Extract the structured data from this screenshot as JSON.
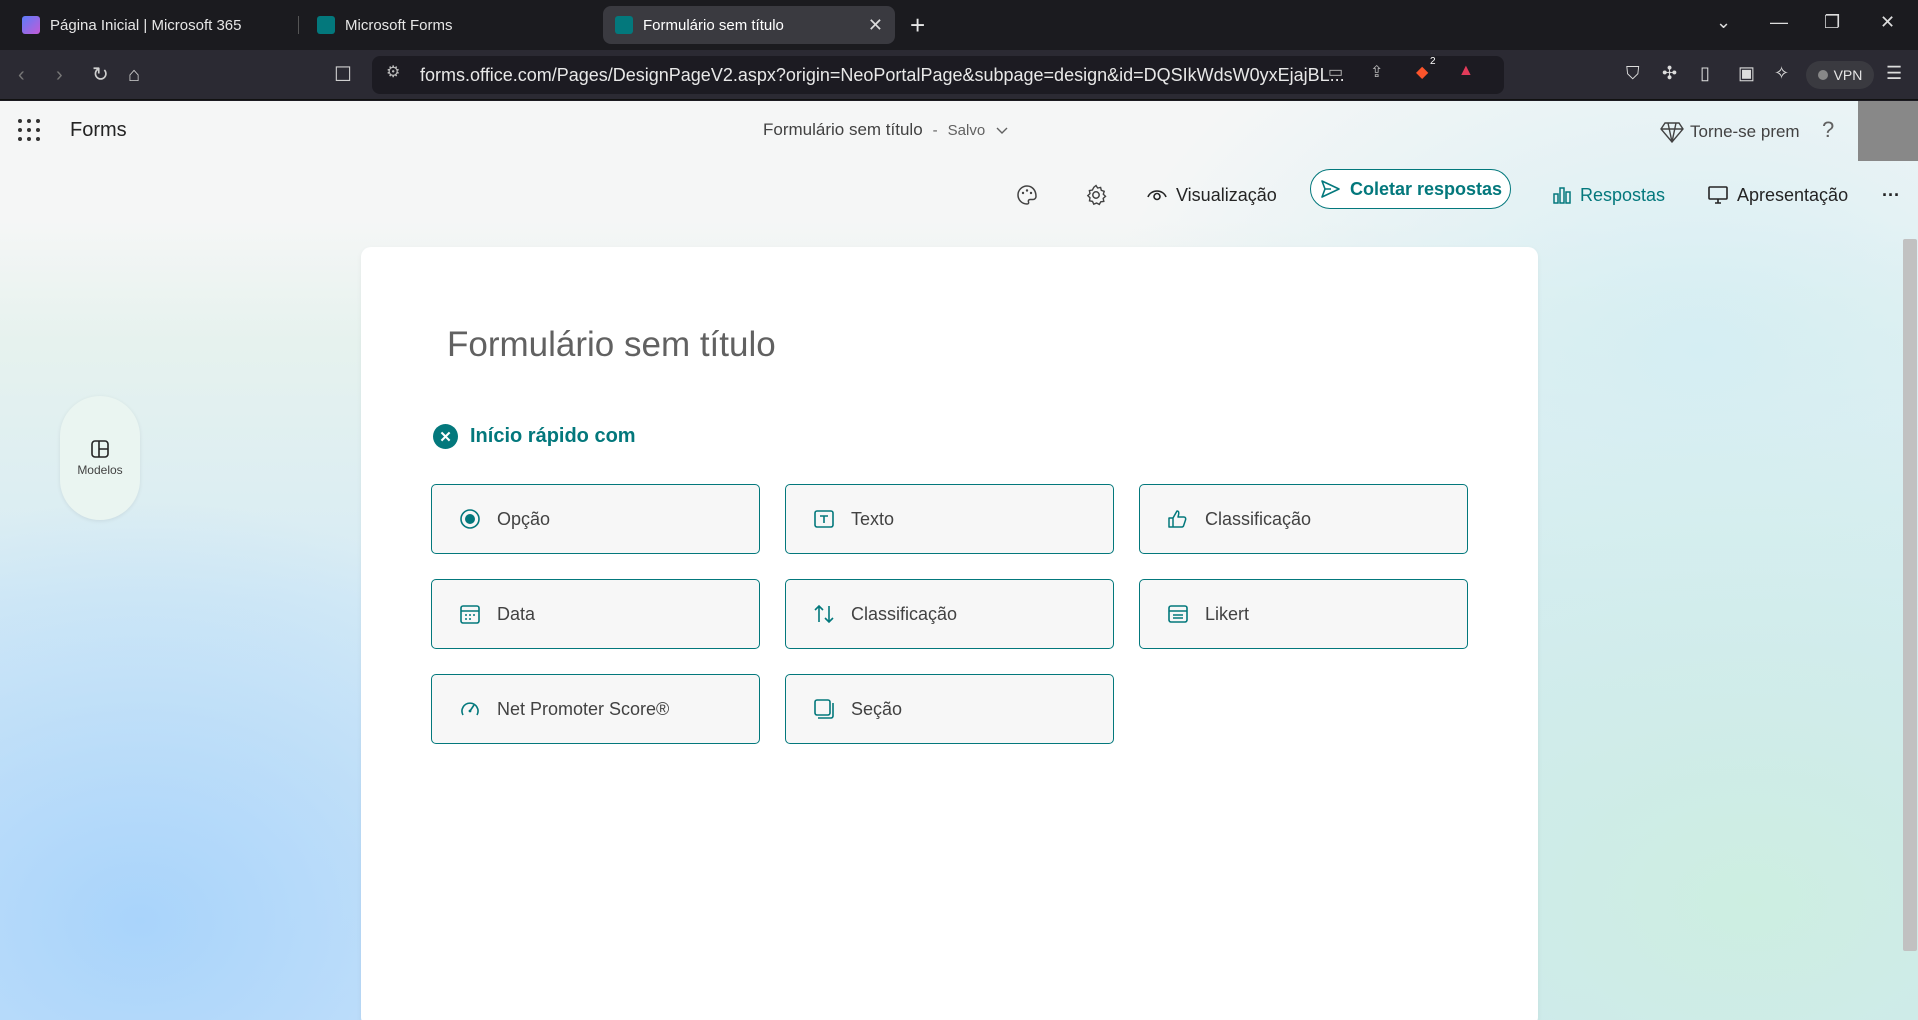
{
  "browser": {
    "tabs": [
      {
        "title": "Página Inicial | Microsoft 365",
        "icon": "copilot-icon"
      },
      {
        "title": "Microsoft Forms",
        "icon": "forms-icon"
      },
      {
        "title": "Formulário sem título",
        "icon": "forms-icon",
        "active": true
      }
    ],
    "url": "forms.office.com/Pages/DesignPageV2.aspx?origin=NeoPortalPage&subpage=design&id=DQSIkWdsW0yxEjajBL...",
    "brave_badge": "2",
    "vpn_label": "VPN"
  },
  "app": {
    "name": "Forms",
    "doc_title": "Formulário sem título",
    "separator": "-",
    "save_status": "Salvo",
    "premium_label": "Torne-se prem",
    "help_label": "?"
  },
  "toolbar": {
    "preview": "Visualização",
    "collect": "Coletar respostas",
    "responses": "Respostas",
    "presentation": "Apresentação",
    "more": "···"
  },
  "sidebar": {
    "templates": "Modelos"
  },
  "form": {
    "title": "Formulário sem título",
    "quick_start": "Início rápido com",
    "options": [
      {
        "label": "Opção",
        "icon": "radio-icon"
      },
      {
        "label": "Texto",
        "icon": "text-box-icon"
      },
      {
        "label": "Classificação",
        "icon": "thumb-icon"
      },
      {
        "label": "Data",
        "icon": "calendar-icon"
      },
      {
        "label": "Classificação",
        "icon": "sort-arrows-icon"
      },
      {
        "label": "Likert",
        "icon": "likert-grid-icon"
      },
      {
        "label": "Net Promoter Score®",
        "icon": "gauge-icon"
      },
      {
        "label": "Seção",
        "icon": "section-icon"
      }
    ]
  },
  "colors": {
    "accent": "#03787c",
    "chrome_bg": "#1b1b1f",
    "urlbar_bg": "#2b2a33"
  }
}
